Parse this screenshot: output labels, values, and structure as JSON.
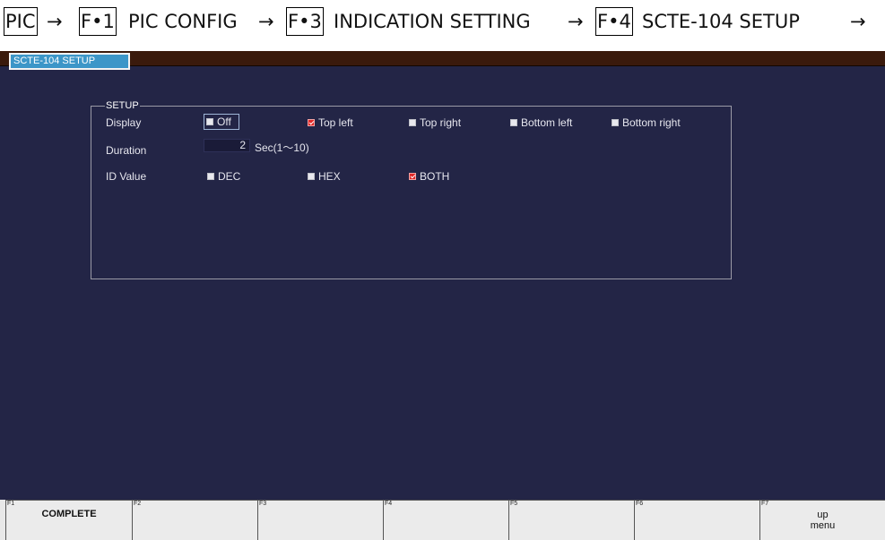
{
  "breadcrumb": {
    "root": "PIC",
    "arrow": "→",
    "steps": [
      {
        "key": "F•1",
        "label": "PIC CONFIG"
      },
      {
        "key": "F•3",
        "label": "INDICATION SETTING"
      },
      {
        "key": "F•4",
        "label": "SCTE-104 SETUP"
      }
    ]
  },
  "tab": {
    "label": "SCTE-104 SETUP"
  },
  "setup": {
    "title": "SETUP",
    "display": {
      "label": "Display",
      "options": [
        "Off",
        "Top left",
        "Top right",
        "Bottom left",
        "Bottom right"
      ],
      "selected": "Top left",
      "focused": "Off"
    },
    "duration": {
      "label": "Duration",
      "value": "2",
      "unit": "Sec(1～10)"
    },
    "id_value": {
      "label": "ID Value",
      "options": [
        "DEC",
        "HEX",
        "BOTH"
      ],
      "selected": "BOTH"
    }
  },
  "fkeys": [
    {
      "num": "F1",
      "label": "COMPLETE"
    },
    {
      "num": "F2",
      "label": ""
    },
    {
      "num": "F3",
      "label": ""
    },
    {
      "num": "F4",
      "label": ""
    },
    {
      "num": "F5",
      "label": ""
    },
    {
      "num": "F6",
      "label": ""
    },
    {
      "num": "F7",
      "label": "up\nmenu"
    }
  ],
  "colors": {
    "screen_bg": "#232546",
    "tab_accent": "#3c96c8",
    "tabstrip": "#3a1a0c",
    "selected_check": "#e02828"
  }
}
